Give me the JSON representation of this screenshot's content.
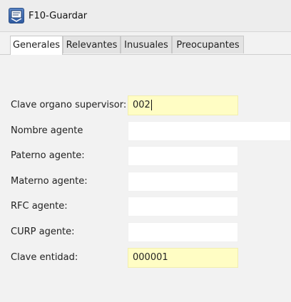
{
  "toolbar": {
    "save_label": "F10-Guardar",
    "save_icon": "save-form-icon"
  },
  "tabs": [
    {
      "label": "Generales",
      "active": true
    },
    {
      "label": "Relevantes",
      "active": false
    },
    {
      "label": "Inusuales",
      "active": false
    },
    {
      "label": "Preocupantes",
      "active": false
    }
  ],
  "form": {
    "clave_organo": {
      "label": "Clave organo supervisor:",
      "value": "002"
    },
    "nombre_agente": {
      "label": "Nombre agente",
      "value": ""
    },
    "paterno_agente": {
      "label": "Paterno agente:",
      "value": ""
    },
    "materno_agente": {
      "label": "Materno agente:",
      "value": ""
    },
    "rfc_agente": {
      "label": "RFC agente:",
      "value": ""
    },
    "curp_agente": {
      "label": "CURP agente:",
      "value": ""
    },
    "clave_entidad": {
      "label": "Clave entidad:",
      "value": "000001"
    }
  },
  "colors": {
    "required_field_bg": "#fffdc4",
    "icon_blue": "#2f5aa0"
  }
}
